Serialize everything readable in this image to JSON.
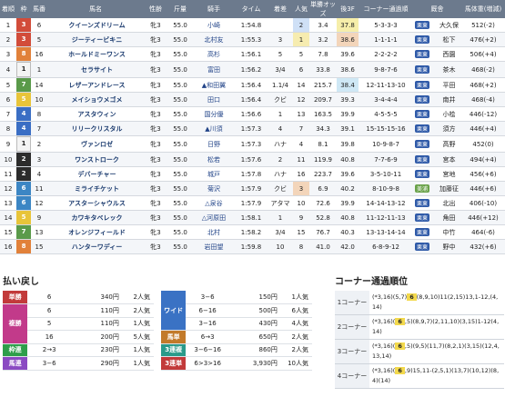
{
  "headers": [
    "着順",
    "枠",
    "馬番",
    "馬名",
    "性齢",
    "斤量",
    "騎手",
    "タイム",
    "着差",
    "人気",
    "単勝オッズ",
    "後3F",
    "コーナー通過順",
    "厩舎",
    "馬体重(増減)"
  ],
  "rows": [
    {
      "rank": "1",
      "waku": "3",
      "num": "6",
      "name": "クイーンズドリーム",
      "sex": "牝3",
      "kin": "55.0",
      "jockey": "小崎",
      "time": "1:54.8",
      "diff": "",
      "pop": "2",
      "odds": "3.4",
      "f3": "37.8",
      "corner": "5-3-3-3",
      "area": "栗東",
      "trainer": "大久保",
      "weight": "512(-2)",
      "wc": "#d24c3a",
      "pc": "h1",
      "fc": "o3"
    },
    {
      "rank": "2",
      "waku": "3",
      "num": "5",
      "name": "ジーティービキニ",
      "sex": "牝3",
      "kin": "55.0",
      "jockey": "北村友",
      "time": "1:55.3",
      "diff": "3",
      "pop": "1",
      "odds": "3.2",
      "f3": "38.6",
      "corner": "1-1-1-1",
      "area": "栗東",
      "trainer": "松下",
      "weight": "476(+2)",
      "wc": "#d24c3a",
      "pc": "h2",
      "fc": "h3"
    },
    {
      "rank": "3",
      "waku": "8",
      "num": "16",
      "name": "ホールドミーワンス",
      "sex": "牝3",
      "kin": "55.0",
      "jockey": "高杉",
      "time": "1:56.1",
      "diff": "5",
      "pop": "5",
      "odds": "7.8",
      "f3": "39.6",
      "corner": "2-2-2-2",
      "area": "栗東",
      "trainer": "西園",
      "weight": "506(+4)",
      "wc": "#e1813a",
      "pc": "",
      "fc": ""
    },
    {
      "rank": "4",
      "waku": "1",
      "num": "1",
      "name": "セラサイト",
      "sex": "牝3",
      "kin": "55.0",
      "jockey": "富田",
      "time": "1:56.2",
      "diff": "3/4",
      "pop": "6",
      "odds": "33.8",
      "f3": "38.6",
      "corner": "9-8-7-6",
      "area": "栗東",
      "trainer": "茶木",
      "weight": "468(-2)",
      "wc": "#f4f4f4",
      "pc": "",
      "fc": ""
    },
    {
      "rank": "5",
      "waku": "7",
      "num": "14",
      "name": "レザーアンドレース",
      "sex": "牝3",
      "kin": "55.0",
      "jockey": "▲和田翼",
      "time": "1:56.4",
      "diff": "1.1/4",
      "pop": "14",
      "odds": "215.7",
      "f3": "38.4",
      "corner": "12-11-13-10",
      "area": "栗東",
      "trainer": "平田",
      "weight": "468(+2)",
      "wc": "#5a9a4a",
      "pc": "",
      "fc": "o3b"
    },
    {
      "rank": "6",
      "waku": "5",
      "num": "10",
      "name": "メイショウメゴメ",
      "sex": "牝3",
      "kin": "55.0",
      "jockey": "田口",
      "time": "1:56.4",
      "diff": "クビ",
      "pop": "12",
      "odds": "209.7",
      "f3": "39.3",
      "corner": "3-4-4-4",
      "area": "栗東",
      "trainer": "南井",
      "weight": "468(-4)",
      "wc": "#e8c43a",
      "pc": "",
      "fc": ""
    },
    {
      "rank": "7",
      "waku": "4",
      "num": "8",
      "name": "アスタウィン",
      "sex": "牝3",
      "kin": "55.0",
      "jockey": "国分優",
      "time": "1:56.6",
      "diff": "1",
      "pop": "13",
      "odds": "163.5",
      "f3": "39.9",
      "corner": "4-5-5-5",
      "area": "栗東",
      "trainer": "小桧",
      "weight": "446(-12)",
      "wc": "#3a6ec4",
      "pc": "",
      "fc": ""
    },
    {
      "rank": "8",
      "waku": "4",
      "num": "7",
      "name": "リリークリスタル",
      "sex": "牝3",
      "kin": "55.0",
      "jockey": "▲川須",
      "time": "1:57.3",
      "diff": "4",
      "pop": "7",
      "odds": "34.3",
      "f3": "39.1",
      "corner": "15-15-15-16",
      "area": "栗東",
      "trainer": "須方",
      "weight": "446(+4)",
      "wc": "#3a6ec4",
      "pc": "",
      "fc": ""
    },
    {
      "rank": "9",
      "waku": "1",
      "num": "2",
      "name": "ヴァンロゼ",
      "sex": "牝3",
      "kin": "55.0",
      "jockey": "日野",
      "time": "1:57.3",
      "diff": "ハナ",
      "pop": "4",
      "odds": "8.1",
      "f3": "39.8",
      "corner": "10-9-8-7",
      "area": "栗東",
      "trainer": "高野",
      "weight": "452(0)",
      "wc": "#f4f4f4",
      "pc": "",
      "fc": ""
    },
    {
      "rank": "10",
      "waku": "2",
      "num": "3",
      "name": "ワンストローク",
      "sex": "牝3",
      "kin": "55.0",
      "jockey": "松若",
      "time": "1:57.6",
      "diff": "2",
      "pop": "11",
      "odds": "119.9",
      "f3": "40.8",
      "corner": "7-7-6-9",
      "area": "栗東",
      "trainer": "宮本",
      "weight": "494(+4)",
      "wc": "#2c2c2c",
      "pc": "",
      "fc": ""
    },
    {
      "rank": "11",
      "waku": "2",
      "num": "4",
      "name": "デバーチャー",
      "sex": "牝3",
      "kin": "55.0",
      "jockey": "城戸",
      "time": "1:57.8",
      "diff": "ハナ",
      "pop": "16",
      "odds": "223.7",
      "f3": "39.6",
      "corner": "3-5-10-11",
      "area": "栗東",
      "trainer": "宮地",
      "weight": "456(+6)",
      "wc": "#2c2c2c",
      "pc": "",
      "fc": ""
    },
    {
      "rank": "12",
      "waku": "6",
      "num": "11",
      "name": "ミライチケット",
      "sex": "牝3",
      "kin": "55.0",
      "jockey": "菊沢",
      "time": "1:57.9",
      "diff": "クビ",
      "pop": "3",
      "odds": "6.9",
      "f3": "40.2",
      "corner": "8-10-9-8",
      "area": "美浦",
      "trainer": "加藤征",
      "weight": "446(+6)",
      "wc": "#3c86c4",
      "pc": "h3",
      "fc": ""
    },
    {
      "rank": "13",
      "waku": "6",
      "num": "12",
      "name": "アスターシャウルス",
      "sex": "牝3",
      "kin": "55.0",
      "jockey": "△泉谷",
      "time": "1:57.9",
      "diff": "アタマ",
      "pop": "10",
      "odds": "72.6",
      "f3": "39.9",
      "corner": "14-14-13-12",
      "area": "栗東",
      "trainer": "北出",
      "weight": "406(-10)",
      "wc": "#3c86c4",
      "pc": "",
      "fc": ""
    },
    {
      "rank": "14",
      "waku": "5",
      "num": "9",
      "name": "カワキタベレック",
      "sex": "牝3",
      "kin": "55.0",
      "jockey": "△河原田",
      "time": "1:58.1",
      "diff": "1",
      "pop": "9",
      "odds": "52.8",
      "f3": "40.8",
      "corner": "11-12-11-13",
      "area": "栗東",
      "trainer": "角田",
      "weight": "446(+12)",
      "wc": "#e8c43a",
      "pc": "",
      "fc": ""
    },
    {
      "rank": "15",
      "waku": "7",
      "num": "13",
      "name": "オレンジフィールド",
      "sex": "牝3",
      "kin": "55.0",
      "jockey": "北村",
      "time": "1:58.2",
      "diff": "3/4",
      "pop": "15",
      "odds": "76.7",
      "f3": "40.3",
      "corner": "13-13-14-14",
      "area": "栗東",
      "trainer": "中竹",
      "weight": "464(-6)",
      "wc": "#5a9a4a",
      "pc": "",
      "fc": ""
    },
    {
      "rank": "16",
      "waku": "8",
      "num": "15",
      "name": "ハンターワディー",
      "sex": "牝3",
      "kin": "55.0",
      "jockey": "岩田望",
      "time": "1:59.8",
      "diff": "10",
      "pop": "8",
      "odds": "41.0",
      "f3": "42.0",
      "corner": "6-8-9-12",
      "area": "栗東",
      "trainer": "野中",
      "weight": "432(+6)",
      "wc": "#e1813a",
      "pc": "",
      "fc": ""
    }
  ],
  "payout_title": "払い戻し",
  "payout_left": [
    {
      "type": "単勝",
      "color": "#c23a3a",
      "combo": "6",
      "amount": "340円",
      "pop": "2人気",
      "span": 1
    },
    {
      "type": "複勝",
      "color": "#c23a8a",
      "combo": "6",
      "amount": "110円",
      "pop": "2人気",
      "span": 3
    },
    {
      "type": "",
      "color": "",
      "combo": "5",
      "amount": "110円",
      "pop": "1人気",
      "span": 0
    },
    {
      "type": "",
      "color": "",
      "combo": "16",
      "amount": "200円",
      "pop": "5人気",
      "span": 0
    },
    {
      "type": "枠連",
      "color": "#2e9e4a",
      "combo": "2→3",
      "amount": "230円",
      "pop": "1人気",
      "span": 1
    },
    {
      "type": "馬連",
      "color": "#8a4ac2",
      "combo": "3−6",
      "amount": "290円",
      "pop": "1人気",
      "span": 1
    }
  ],
  "payout_right": [
    {
      "type": "ワイド",
      "color": "#3a72c4",
      "combo": "3−6",
      "amount": "150円",
      "pop": "1人気",
      "span": 3
    },
    {
      "type": "",
      "color": "",
      "combo": "6−16",
      "amount": "500円",
      "pop": "6人気",
      "span": 0
    },
    {
      "type": "",
      "color": "",
      "combo": "3−16",
      "amount": "430円",
      "pop": "4人気",
      "span": 0
    },
    {
      "type": "馬単",
      "color": "#c27a2a",
      "combo": "6→3",
      "amount": "650円",
      "pop": "2人気",
      "span": 1
    },
    {
      "type": "3連複",
      "color": "#2a9a8a",
      "combo": "3−6−16",
      "amount": "860円",
      "pop": "2人気",
      "span": 1
    },
    {
      "type": "3連単",
      "color": "#c23a3a",
      "combo": "6>3>16",
      "amount": "3,930円",
      "pop": "10人気",
      "span": 1
    }
  ],
  "corner_title": "コーナー通過順位",
  "corners": [
    {
      "label": "1コーナー",
      "pre": "(*3,16)(5,7)",
      "hl": "6",
      "post": "(8,9,10)11(2,15)13,1-12,(4,14)"
    },
    {
      "label": "2コーナー",
      "pre": "(*3,16)(",
      "hl": "6",
      "post": ",5)(8,9,7)(2,11,10)(3,15)1-12(4,14)"
    },
    {
      "label": "3コーナー",
      "pre": "(*3,16)(",
      "hl": "6",
      "post": ",5)(9,5)(11,7)(8,2,1)(3,15)(12,4,13,14)"
    },
    {
      "label": "4コーナー",
      "pre": "(*3,16)(",
      "hl": "6",
      "post": ",9)15,11-(2,5,1)(13,7)(10,12)(8,4)(14)"
    }
  ]
}
